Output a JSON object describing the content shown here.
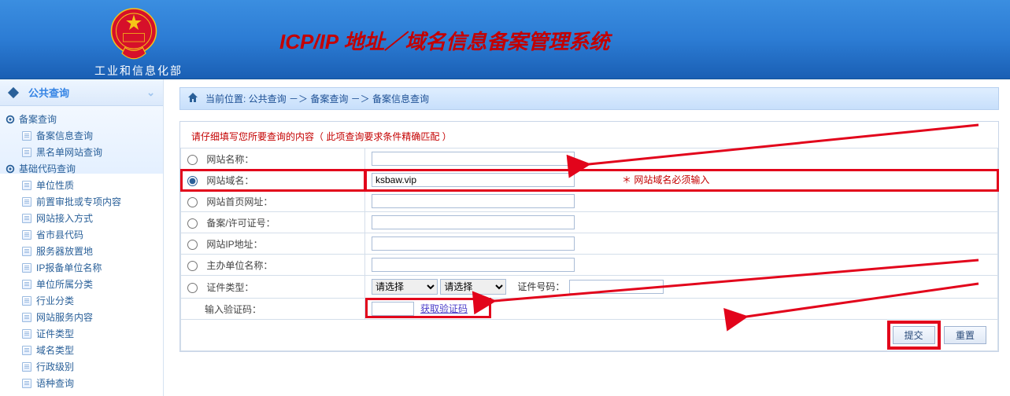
{
  "header": {
    "ministry": "工业和信息化部",
    "title": "ICP/IP 地址／域名信息备案管理系统"
  },
  "sidebar": {
    "header": "公共查询",
    "groups": [
      {
        "label": "备案查询",
        "items": [
          "备案信息查询",
          "黑名单网站查询"
        ]
      },
      {
        "label": "基础代码查询",
        "items": [
          "单位性质",
          "前置审批或专项内容",
          "网站接入方式",
          "省市县代码",
          "服务器放置地",
          "IP报备单位名称",
          "单位所属分类",
          "行业分类",
          "网站服务内容",
          "证件类型",
          "域名类型",
          "行政级别",
          "语种查询"
        ]
      }
    ]
  },
  "breadcrumb": {
    "prefix": "当前位置:",
    "parts": [
      "公共查询",
      "备案查询",
      "备案信息查询"
    ],
    "sep": "－＞"
  },
  "form": {
    "instructions": "请仔细填写您所要查询的内容（ 此项查询要求条件精确匹配 ）",
    "rows": [
      {
        "key": "site_name",
        "label": "网站名称："
      },
      {
        "key": "domain",
        "label": "网站域名：",
        "value": "ksbaw.vip",
        "hint": "＊ 网站域名必须输入",
        "highlighted": true
      },
      {
        "key": "home_url",
        "label": "网站首页网址："
      },
      {
        "key": "license_no",
        "label": "备案/许可证号："
      },
      {
        "key": "ip",
        "label": "网站IP地址："
      },
      {
        "key": "org_name",
        "label": "主办单位名称："
      }
    ],
    "cert": {
      "label": "证件类型：",
      "select1_placeholder": "请选择",
      "select2_placeholder": "请选择",
      "cert_no_label": "证件号码："
    },
    "captcha": {
      "label": "输入验证码：",
      "get_link": "获取验证码"
    },
    "buttons": {
      "submit": "提交",
      "reset": "重置"
    }
  }
}
